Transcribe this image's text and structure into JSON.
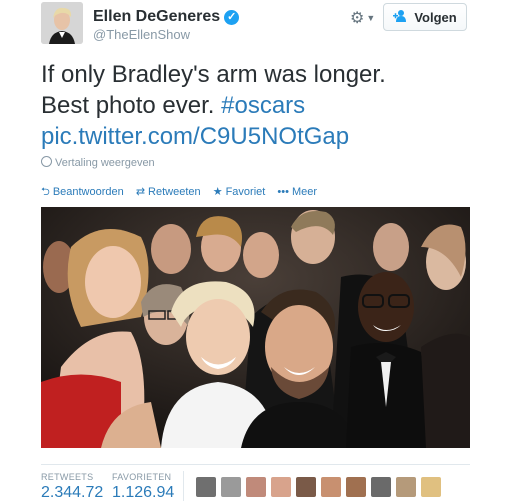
{
  "user": {
    "name": "Ellen DeGeneres",
    "handle": "@TheEllenShow",
    "verified_glyph": "✓",
    "follow_label": "Volgen"
  },
  "tweet": {
    "line1": "If only Bradley's arm was longer.",
    "line2_text": "Best photo ever. ",
    "hashtag": "#oscars",
    "link": "pic.twitter.com/C9U5NOtGap",
    "translate": "Vertaling weergeven"
  },
  "actions": {
    "reply": "Beantwoorden",
    "retweet": "Retweeten",
    "favorite": "Favoriet",
    "more": "Meer"
  },
  "stats": {
    "retweets_label": "RETWEETS",
    "retweets_value": "2.344.72",
    "favorites_label": "FAVORIETEN",
    "favorites_value": "1.126.94"
  },
  "icons": {
    "gear": "gear-icon",
    "follow": "add-user-icon",
    "reply": "reply-arrow-icon",
    "retweet": "retweet-icon",
    "favorite": "star-icon",
    "more": "ellipsis-icon",
    "globe": "globe-icon"
  },
  "colors": {
    "link": "#2b7bb9",
    "verified": "#1da1f2",
    "muted": "#8899a6",
    "text": "#292f33"
  },
  "avatar_colors": [
    "#6f6f6f",
    "#9a9a9a",
    "#c08a7a",
    "#d8a38c",
    "#7a5a48",
    "#c89070",
    "#a07050",
    "#6a6a6a",
    "#b59a7a",
    "#e0c080"
  ]
}
